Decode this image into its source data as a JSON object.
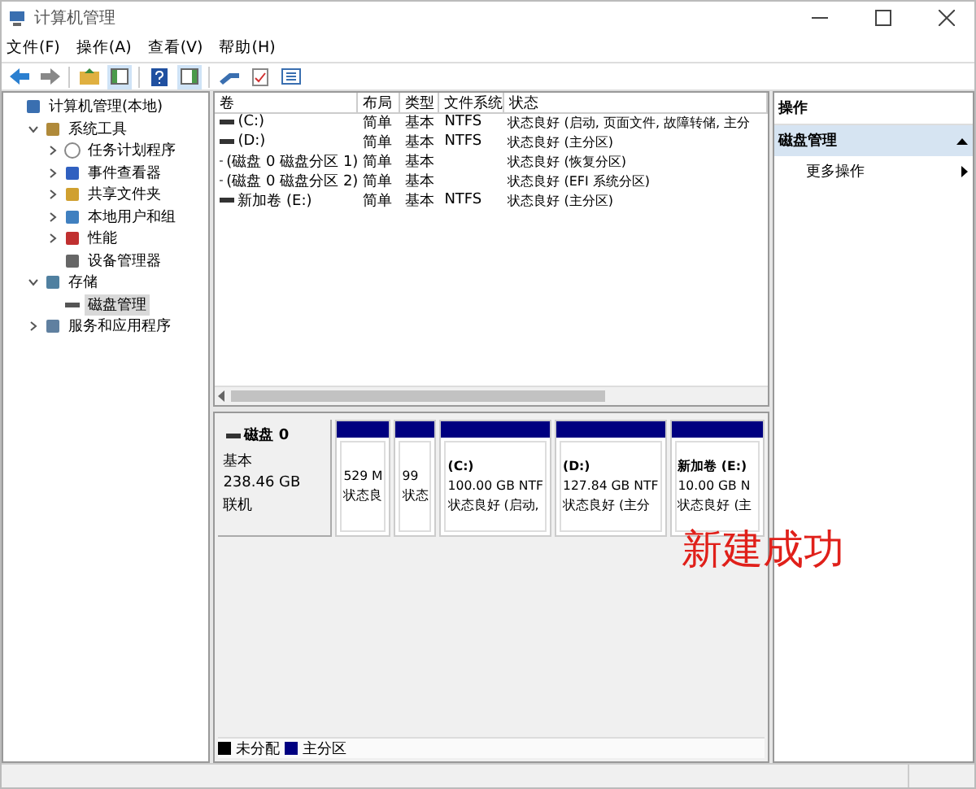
{
  "window": {
    "title": "计算机管理"
  },
  "menu": [
    "文件(F)",
    "操作(A)",
    "查看(V)",
    "帮助(H)"
  ],
  "tree": [
    {
      "label": "计算机管理(本地)",
      "selected": false,
      "children": [
        {
          "label": "系统工具",
          "expanded": true,
          "selected": false,
          "children": [
            {
              "label": "任务计划程序",
              "expanded": false,
              "selected": false
            },
            {
              "label": "事件查看器",
              "expanded": false,
              "selected": false
            },
            {
              "label": "共享文件夹",
              "expanded": false,
              "selected": false
            },
            {
              "label": "本地用户和组",
              "expanded": false,
              "selected": false
            },
            {
              "label": "性能",
              "expanded": false,
              "selected": false
            },
            {
              "label": "设备管理器",
              "selected": false
            }
          ]
        },
        {
          "label": "存储",
          "expanded": true,
          "selected": false,
          "children": [
            {
              "label": "磁盘管理",
              "selected": true
            }
          ]
        },
        {
          "label": "服务和应用程序",
          "expanded": false,
          "selected": false
        }
      ]
    }
  ],
  "table": {
    "columns": [
      "卷",
      "布局",
      "类型",
      "文件系统",
      "状态"
    ],
    "rows": [
      [
        "(C:)",
        "简单",
        "基本",
        "NTFS",
        "状态良好 (启动, 页面文件, 故障转储, 主分"
      ],
      [
        "(D:)",
        "简单",
        "基本",
        "NTFS",
        "状态良好 (主分区)"
      ],
      [
        "(磁盘 0 磁盘分区 1)",
        "简单",
        "基本",
        "",
        "状态良好 (恢复分区)"
      ],
      [
        "(磁盘 0 磁盘分区 2)",
        "简单",
        "基本",
        "",
        "状态良好 (EFI 系统分区)"
      ],
      [
        "新加卷 (E:)",
        "简单",
        "基本",
        "NTFS",
        "状态良好 (主分区)"
      ]
    ]
  },
  "disk": {
    "name": "磁盘 0",
    "type": "基本",
    "size": "238.46 GB",
    "status": "联机",
    "partitions": [
      {
        "lines": [
          "529 M",
          "状态良"
        ]
      },
      {
        "lines": [
          "99",
          "状态"
        ]
      },
      {
        "lines": [
          "(C:)",
          "100.00 GB NTF",
          "状态良好 (启动,"
        ]
      },
      {
        "lines": [
          "(D:)",
          "127.84 GB NTF",
          "状态良好 (主分"
        ]
      },
      {
        "lines": [
          "新加卷  (E:)",
          "10.00 GB N",
          "状态良好 (主"
        ]
      }
    ]
  },
  "legend": [
    {
      "label": "未分配",
      "color": "#000000"
    },
    {
      "label": "主分区",
      "color": "#000080"
    }
  ],
  "annotation": "新建成功",
  "actions": {
    "title": "操作",
    "section": "磁盘管理",
    "items": [
      "更多操作"
    ]
  }
}
